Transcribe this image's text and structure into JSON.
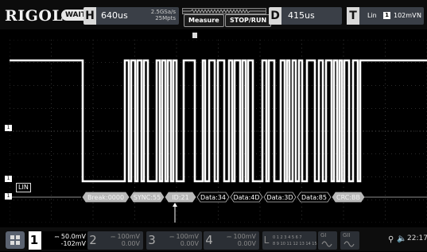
{
  "header": {
    "logo": "RIGOL",
    "run_state": "WAIT",
    "horizontal": {
      "letter": "H",
      "timebase": "640us",
      "sample_rate": "2.5GSa/s",
      "memory_depth": "25Mpts"
    },
    "buttons": {
      "measure": "Measure",
      "stop_run": "STOP/RUN"
    },
    "delay": {
      "letter": "D",
      "value": "415us"
    },
    "trigger": {
      "letter": "T",
      "mode": "Lin",
      "source": "1",
      "level": "102mV",
      "slope": "N"
    }
  },
  "colors": {
    "trace": "#ffffff",
    "grid": "#555555",
    "decode_bus_fill": "#b8b8b8",
    "decode_bus_outline": "#bbbbbb",
    "background": "#000000"
  },
  "display": {
    "channel_markers": [
      "1",
      "1",
      "1"
    ],
    "bus_label": "LIN",
    "decode_packets": [
      {
        "text": "Break:0000",
        "style": "filled"
      },
      {
        "text": "SYNC:55",
        "style": "filled"
      },
      {
        "text": "ID:21",
        "style": "filled"
      },
      {
        "text": "Data:34",
        "style": "outline"
      },
      {
        "text": "Data:4D",
        "style": "outline"
      },
      {
        "text": "Data:3D",
        "style": "outline"
      },
      {
        "text": "Data:85",
        "style": "outline"
      },
      {
        "text": "CRC:BB",
        "style": "filled"
      }
    ]
  },
  "footer": {
    "menu_icon": "apps-grid-icon",
    "channels": [
      {
        "number": "1",
        "coupling": "⎓",
        "scale": "50.0mV",
        "offset": "-102mV",
        "active": true
      },
      {
        "number": "2",
        "coupling": "⎓",
        "scale": "100mV",
        "offset": "0.00V",
        "active": false
      },
      {
        "number": "3",
        "coupling": "⎓",
        "scale": "100mV",
        "offset": "0.00V",
        "active": false
      },
      {
        "number": "4",
        "coupling": "⎓",
        "scale": "100mV",
        "offset": "0.00V",
        "active": false
      }
    ],
    "logic": {
      "letter": "L",
      "row1": "0 1 2 3  4 5 6 7",
      "row2": "8 9 10 11 12 13 14 15"
    },
    "generators": [
      "GI",
      "GII"
    ],
    "usb_icon": "usb-icon",
    "speaker_icon": "speaker-icon",
    "time": "22:17"
  }
}
